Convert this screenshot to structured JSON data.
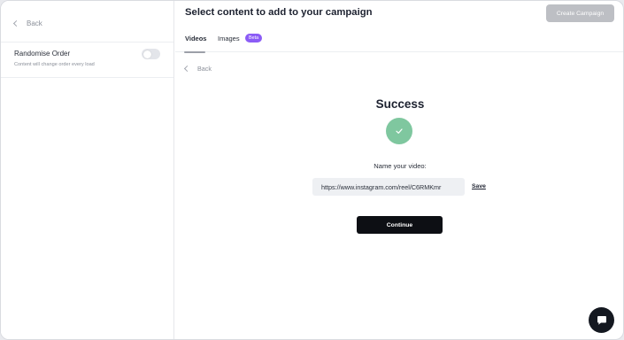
{
  "sidebar": {
    "back_label": "Back",
    "randomise_title": "Randomise Order",
    "randomise_subtitle": "Content will change order every load",
    "randomise_enabled": false
  },
  "header": {
    "title": "Select content to add to your campaign",
    "create_button_label": "Create Campaign"
  },
  "tabs": [
    {
      "label": "Videos",
      "active": true
    },
    {
      "label": "Images",
      "active": false,
      "badge": "Beta"
    }
  ],
  "main": {
    "back_label": "Back",
    "success_title": "Success",
    "name_label": "Name your video:",
    "video_url_value": "https://www.instagram.com/reel/C6RMKmr",
    "save_label": "Save",
    "continue_label": "Continue"
  },
  "icons": {
    "success": "check-icon",
    "chat": "chat-icon"
  },
  "colors": {
    "success_green": "#7fc79f",
    "beta_purple": "#8b5cf6",
    "primary_dark": "#0d0f14",
    "disabled_gray": "#bdbfc4"
  }
}
